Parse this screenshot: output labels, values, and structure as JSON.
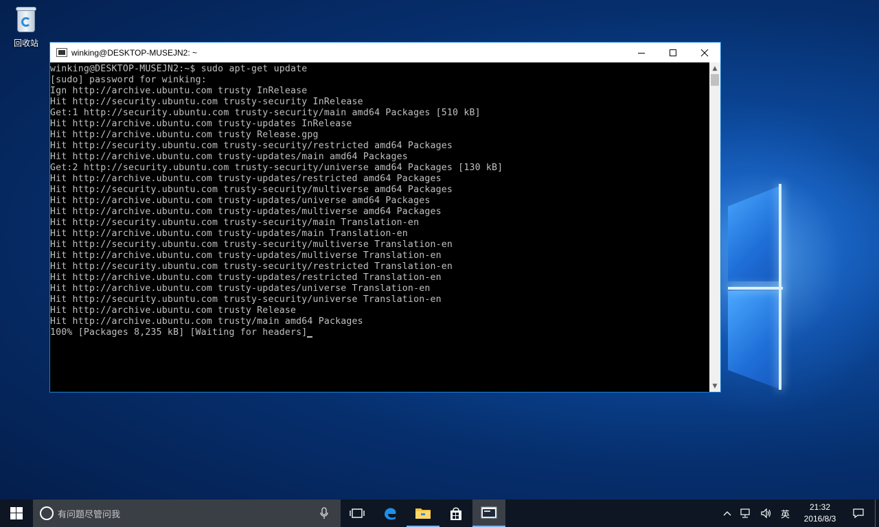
{
  "desktop": {
    "icons": [
      {
        "label": "回收站",
        "icon": "recycle-bin-icon"
      }
    ]
  },
  "window": {
    "title": "winking@DESKTOP-MUSEJN2: ~",
    "buttons": {
      "minimize": "—",
      "maximize": "☐",
      "close": "✕"
    }
  },
  "console": {
    "lines": [
      "winking@DESKTOP-MUSEJN2:~$ sudo apt-get update",
      "[sudo] password for winking:",
      "Ign http://archive.ubuntu.com trusty InRelease",
      "Hit http://security.ubuntu.com trusty-security InRelease",
      "Get:1 http://security.ubuntu.com trusty-security/main amd64 Packages [510 kB]",
      "Hit http://archive.ubuntu.com trusty-updates InRelease",
      "Hit http://archive.ubuntu.com trusty Release.gpg",
      "Hit http://security.ubuntu.com trusty-security/restricted amd64 Packages",
      "Hit http://archive.ubuntu.com trusty-updates/main amd64 Packages",
      "Get:2 http://security.ubuntu.com trusty-security/universe amd64 Packages [130 kB]",
      "Hit http://archive.ubuntu.com trusty-updates/restricted amd64 Packages",
      "Hit http://security.ubuntu.com trusty-security/multiverse amd64 Packages",
      "Hit http://archive.ubuntu.com trusty-updates/universe amd64 Packages",
      "Hit http://archive.ubuntu.com trusty-updates/multiverse amd64 Packages",
      "Hit http://security.ubuntu.com trusty-security/main Translation-en",
      "Hit http://archive.ubuntu.com trusty-updates/main Translation-en",
      "Hit http://security.ubuntu.com trusty-security/multiverse Translation-en",
      "Hit http://archive.ubuntu.com trusty-updates/multiverse Translation-en",
      "Hit http://security.ubuntu.com trusty-security/restricted Translation-en",
      "Hit http://archive.ubuntu.com trusty-updates/restricted Translation-en",
      "Hit http://archive.ubuntu.com trusty-updates/universe Translation-en",
      "Hit http://security.ubuntu.com trusty-security/universe Translation-en",
      "Hit http://archive.ubuntu.com trusty Release",
      "Hit http://archive.ubuntu.com trusty/main amd64 Packages",
      "100% [Packages 8,235 kB] [Waiting for headers]"
    ]
  },
  "taskbar": {
    "search_placeholder": "有问题尽管问我",
    "apps": [
      "task-view-icon",
      "edge-icon",
      "file-explorer-icon",
      "store-icon",
      "console-icon"
    ],
    "tray": {
      "ime_label": "英",
      "time": "21:32",
      "date": "2016/8/3"
    }
  },
  "colors": {
    "window_border": "#1a7fd4",
    "console_bg": "#000000",
    "console_fg": "#c0c0c0",
    "taskbar_bg": "#0d1622",
    "accent": "#7ab3ec"
  }
}
